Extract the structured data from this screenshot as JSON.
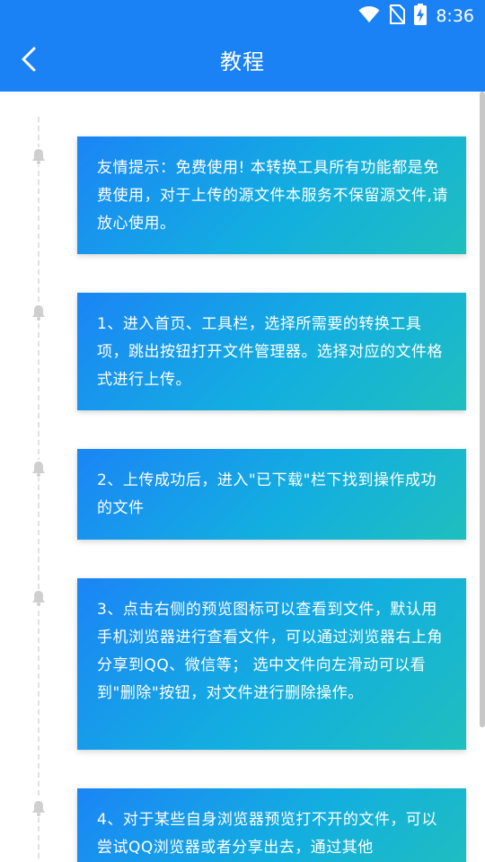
{
  "status_bar": {
    "time": "8:36",
    "icons": [
      "wifi-icon",
      "no-sim-icon",
      "battery-charging-icon"
    ]
  },
  "nav": {
    "title": "教程",
    "back_icon": "chevron-left-icon"
  },
  "colors": {
    "header": "#1a82f4",
    "card_gradient_start": "#1b85f6",
    "card_gradient_end": "#1fbfbe",
    "timeline": "#e2e2e2",
    "bell": "#cfcfcf"
  },
  "steps": [
    {
      "icon": "bell-icon",
      "text": "友情提示：免费使用! 本转换工具所有功能都是免费使用，对于上传的源文件本服务不保留源文件,请放心使用。"
    },
    {
      "icon": "bell-icon",
      "text": "1、进入首页、工具栏，选择所需要的转换工具项，跳出按钮打开文件管理器。选择对应的文件格式进行上传。"
    },
    {
      "icon": "bell-icon",
      "text": "2、上传成功后，进入\"已下载\"栏下找到操作成功的文件"
    },
    {
      "icon": "bell-icon",
      "text": "3、点击右侧的预览图标可以查看到文件，默认用手机浏览器进行查看文件，可以通过浏览器右上角分享到QQ、微信等；  选中文件向左滑动可以看到\"删除\"按钮，对文件进行删除操作。"
    },
    {
      "icon": "bell-icon",
      "text": "4、对于某些自身浏览器预览打不开的文件，可以尝试QQ浏览器或者分享出去，通过其他"
    }
  ]
}
